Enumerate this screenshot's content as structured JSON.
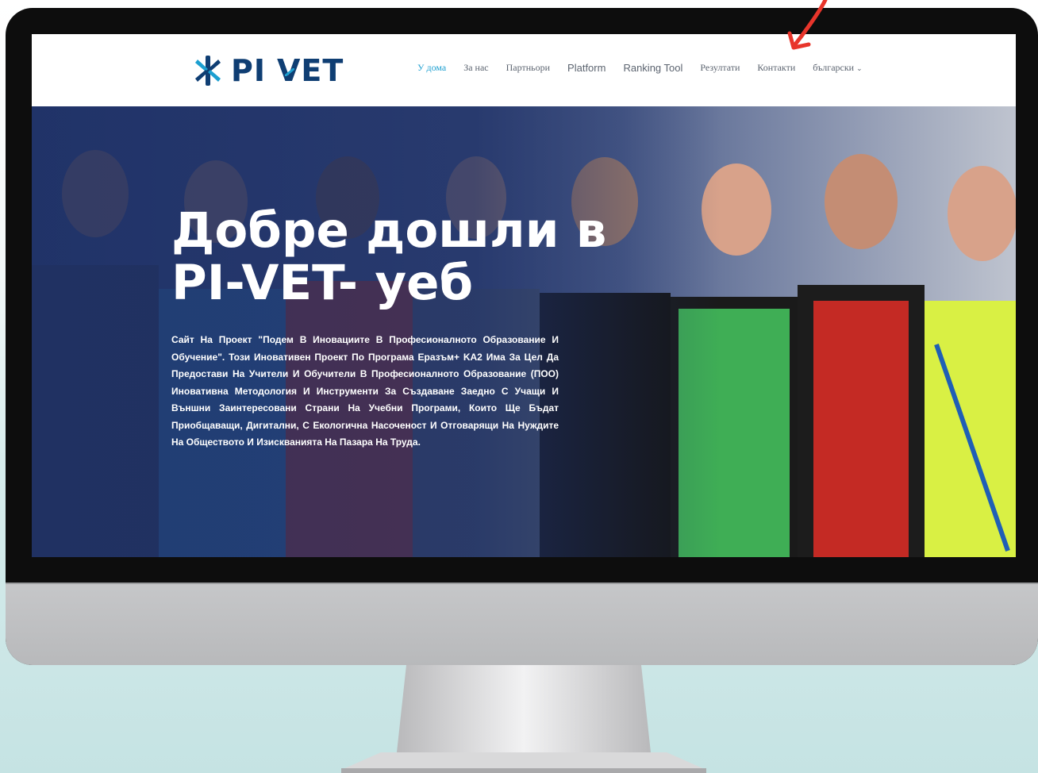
{
  "navbar": {
    "logo": {
      "part1": "PI",
      "part2": "VET"
    },
    "items": [
      {
        "label": "У дома",
        "active": true
      },
      {
        "label": "За нас"
      },
      {
        "label": "Партньори"
      },
      {
        "label": "Platform"
      },
      {
        "label": "Ranking Tool"
      },
      {
        "label": "Резултати"
      },
      {
        "label": "Контакти"
      },
      {
        "label": "български"
      }
    ]
  },
  "hero": {
    "title_line1": "Добре дошли в",
    "title_line2": "PI-VET- уеб",
    "description": "Сайт На Проект \"Подем В Иновациите В Професионалното Образование И Обучение\". Този Иновативен Проект По Програма Еразъм+ KA2 Има За Цел Да Предостави На Учители И Обучители В Професионалното Образование (ПОО) Иновативна Методология И Инструменти За Създаване Заедно С Учащи И Външни Заинтересовани Страни На Учебни Програми, Които Ще Бъдат Приобщаващи, Дигитални, С Екологична Насоченост И Отговарящи На Нуждите На Обществото И Изискванията На Пазара На Труда."
  },
  "colors": {
    "brand_dark": "#0f3e73",
    "brand_accent": "#1c9fd0",
    "hero_overlay": "#1e3066",
    "annotation_arrow": "#e8352b"
  },
  "icons": {
    "logo": "pi-vet-logo-icon",
    "dropdown": "chevron-down-icon",
    "annotation": "red-arrow-icon"
  }
}
